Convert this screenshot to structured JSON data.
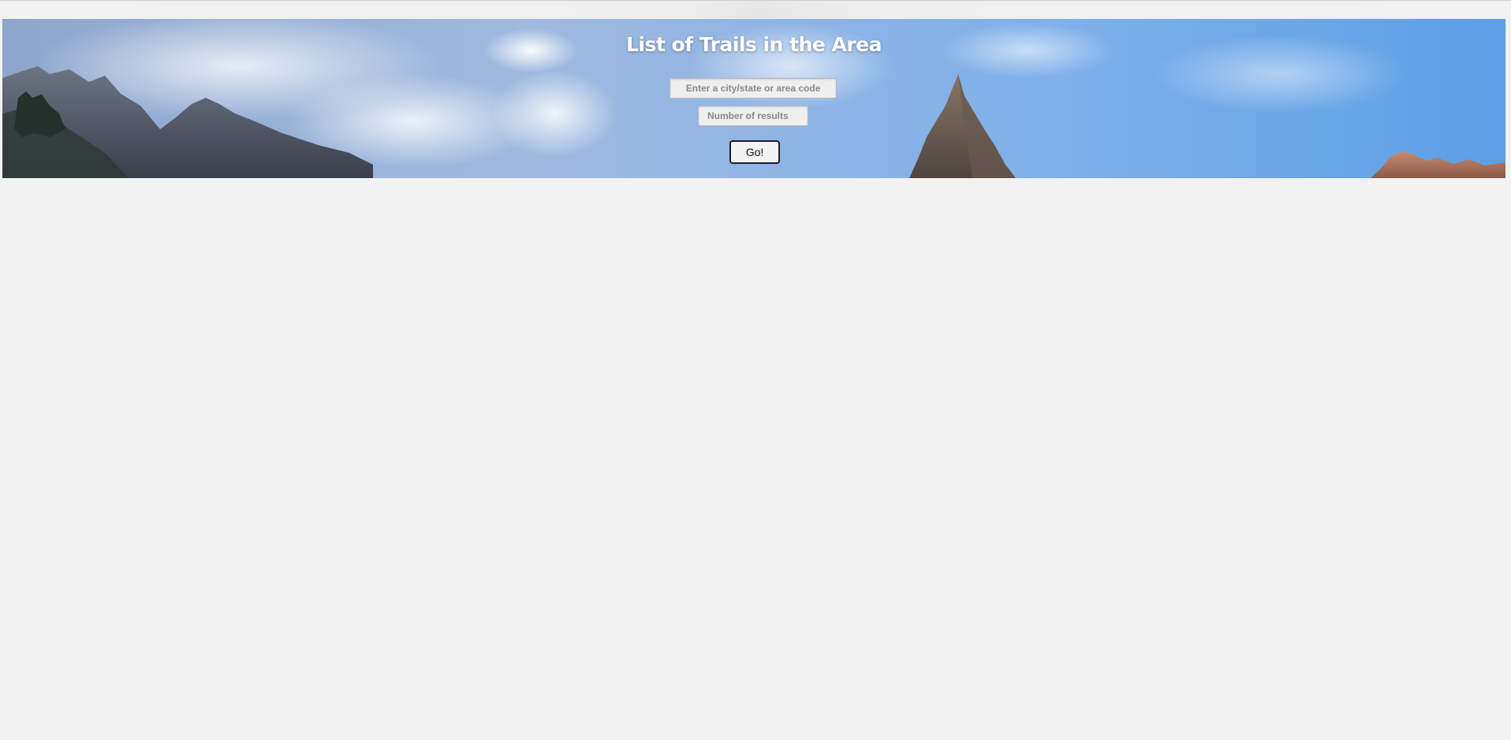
{
  "hero": {
    "title": "List of Trails in the Area",
    "background": "mountain-panorama-image"
  },
  "search": {
    "location_placeholder": "Enter a city/state or area code",
    "location_value": "",
    "results_placeholder": "Number of results",
    "results_value": "",
    "go_label": "Go!"
  },
  "colors": {
    "page_background": "#f2f2f2",
    "title": "#ffffff",
    "button_border": "#1a1a2e"
  }
}
